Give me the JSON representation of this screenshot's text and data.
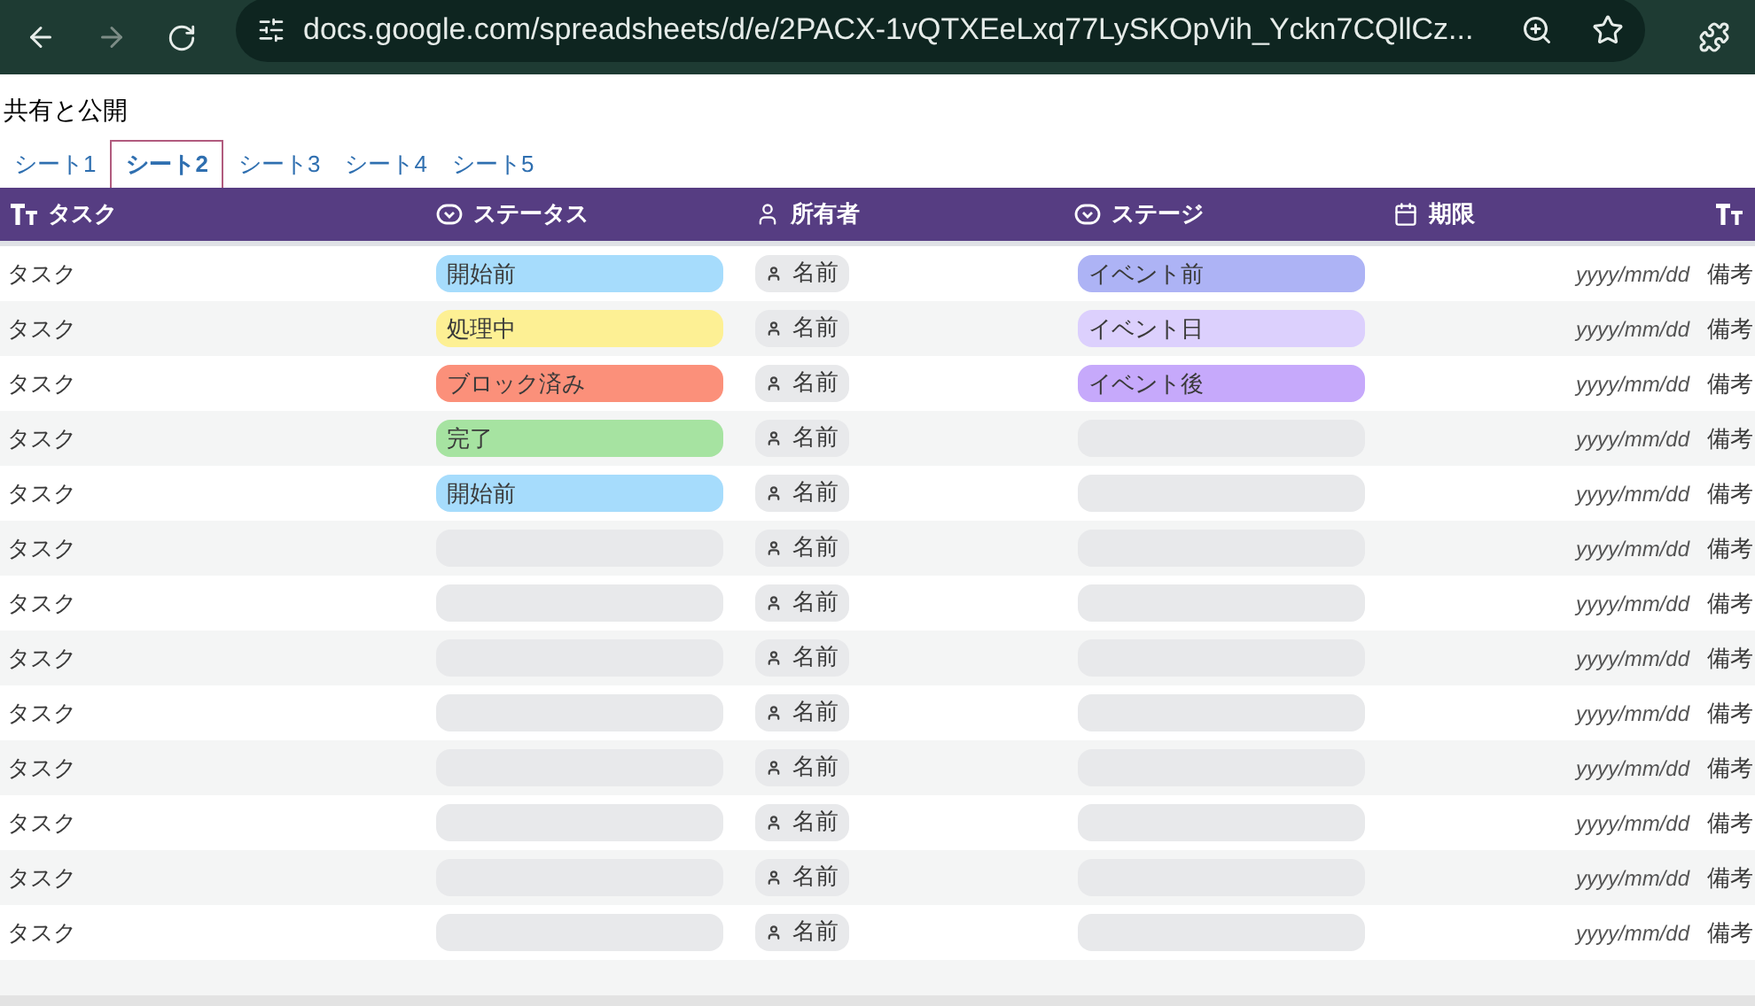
{
  "browser": {
    "url": "docs.google.com/spreadsheets/d/e/2PACX-1vQTXEeLxq77LySKOpVih_Yckn7CQllCz...",
    "forward_disabled": true
  },
  "title": "共有と公開",
  "tabs": [
    {
      "label": "シート1",
      "selected": false
    },
    {
      "label": "シート2",
      "selected": true
    },
    {
      "label": "シート3",
      "selected": false
    },
    {
      "label": "シート4",
      "selected": false
    },
    {
      "label": "シート5",
      "selected": false
    }
  ],
  "table": {
    "columns": [
      {
        "label": "タスク",
        "kind": "text"
      },
      {
        "label": "ステータス",
        "kind": "dropdown"
      },
      {
        "label": "所有者",
        "kind": "person"
      },
      {
        "label": "ステージ",
        "kind": "dropdown"
      },
      {
        "label": "期限",
        "kind": "date"
      },
      {
        "kind": "text"
      }
    ],
    "rows": [
      {
        "task": "タスク",
        "status": {
          "label": "開始前",
          "color": "#a6dcfc"
        },
        "owner": "名前",
        "stage": {
          "label": "イベント前",
          "color": "#adb3f5"
        },
        "due": "yyyy/mm/dd",
        "notes": "備考"
      },
      {
        "task": "タスク",
        "status": {
          "label": "処理中",
          "color": "#fdf094"
        },
        "owner": "名前",
        "stage": {
          "label": "イベント日",
          "color": "#dcd0fd"
        },
        "due": "yyyy/mm/dd",
        "notes": "備考"
      },
      {
        "task": "タスク",
        "status": {
          "label": "ブロック済み",
          "color": "#fb907a"
        },
        "owner": "名前",
        "stage": {
          "label": "イベント後",
          "color": "#c6a9fb"
        },
        "due": "yyyy/mm/dd",
        "notes": "備考"
      },
      {
        "task": "タスク",
        "status": {
          "label": "完了",
          "color": "#a6e3a1"
        },
        "owner": "名前",
        "due": "yyyy/mm/dd",
        "notes": "備考"
      },
      {
        "task": "タスク",
        "status": {
          "label": "開始前",
          "color": "#a6dcfc"
        },
        "owner": "名前",
        "due": "yyyy/mm/dd",
        "notes": "備考"
      },
      {
        "task": "タスク",
        "owner": "名前",
        "due": "yyyy/mm/dd",
        "notes": "備考"
      },
      {
        "task": "タスク",
        "owner": "名前",
        "due": "yyyy/mm/dd",
        "notes": "備考"
      },
      {
        "task": "タスク",
        "owner": "名前",
        "due": "yyyy/mm/dd",
        "notes": "備考"
      },
      {
        "task": "タスク",
        "owner": "名前",
        "due": "yyyy/mm/dd",
        "notes": "備考"
      },
      {
        "task": "タスク",
        "owner": "名前",
        "due": "yyyy/mm/dd",
        "notes": "備考"
      },
      {
        "task": "タスク",
        "owner": "名前",
        "due": "yyyy/mm/dd",
        "notes": "備考"
      },
      {
        "task": "タスク",
        "owner": "名前",
        "due": "yyyy/mm/dd",
        "notes": "備考"
      },
      {
        "task": "タスク",
        "owner": "名前",
        "due": "yyyy/mm/dd",
        "notes": "備考"
      }
    ]
  }
}
